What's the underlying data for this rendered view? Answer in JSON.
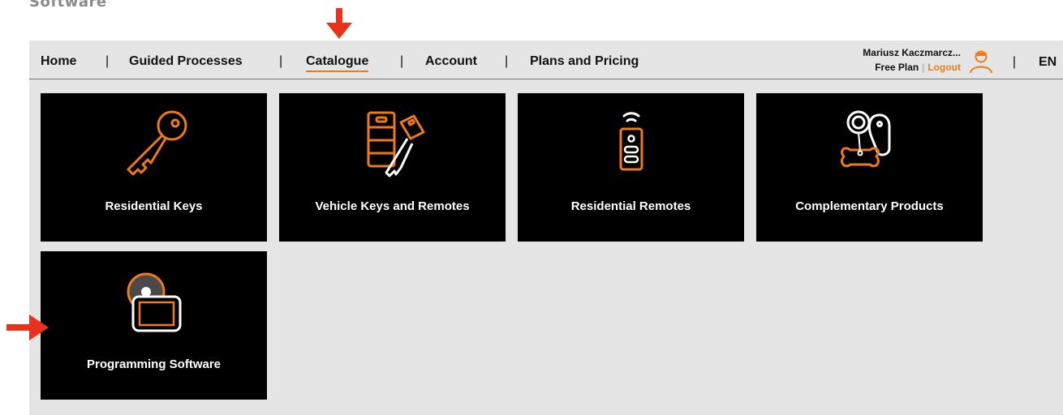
{
  "doc": {
    "heading": "Software"
  },
  "nav": {
    "items": [
      {
        "label": "Home"
      },
      {
        "label": "Guided Processes"
      },
      {
        "label": "Catalogue",
        "active": true
      },
      {
        "label": "Account"
      },
      {
        "label": "Plans and Pricing"
      }
    ],
    "separator": "|"
  },
  "user": {
    "name": "Mariusz Kaczmarcz...",
    "plan": "Free Plan",
    "plan_separator": "|",
    "logout": "Logout",
    "lang_separator": "|",
    "language": "EN"
  },
  "catalogue": {
    "tiles": [
      {
        "label": "Residential Keys",
        "icon": "key-icon"
      },
      {
        "label": "Vehicle Keys and Remotes",
        "icon": "vehicle-key-remote-icon"
      },
      {
        "label": "Residential Remotes",
        "icon": "remote-control-icon"
      },
      {
        "label": "Complementary Products",
        "icon": "key-tags-icon"
      },
      {
        "label": "Programming Software",
        "icon": "programming-device-icon"
      }
    ]
  },
  "colors": {
    "accent": "#ee7a1a",
    "tile_bg": "#000000",
    "page_bg": "#e5e5e5",
    "annotation": "#e8321e"
  }
}
